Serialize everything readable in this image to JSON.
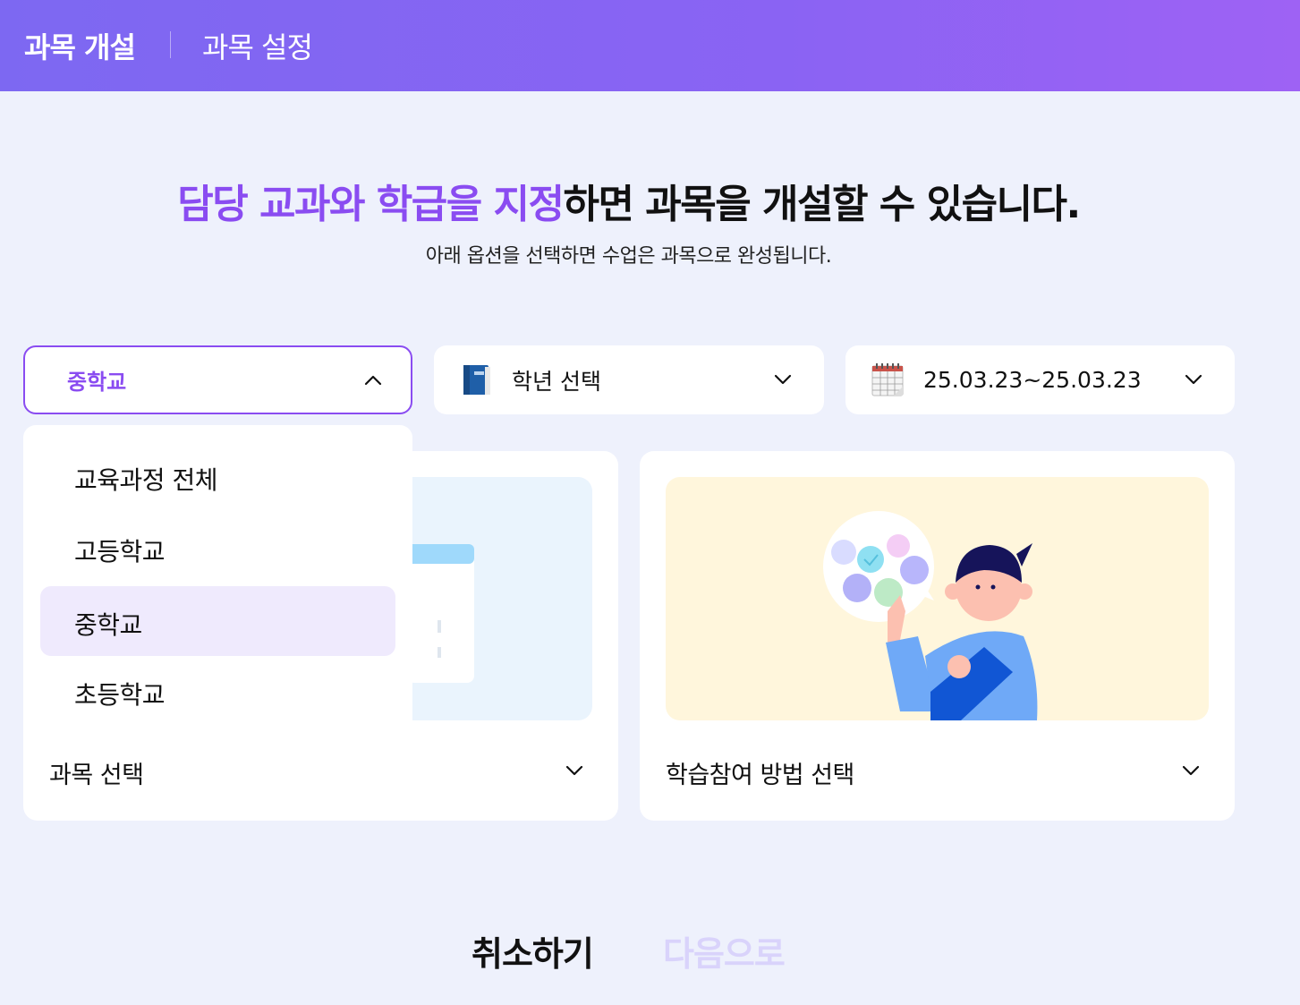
{
  "header": {
    "tab_main": "과목 개설",
    "tab_sub": "과목 설정"
  },
  "intro": {
    "headline_highlight_1": "담당 교과",
    "headline_mid_1": "와 ",
    "headline_highlight_2": "학급을 지정",
    "headline_rest": "하면 과목을 개설할 수 있습니다.",
    "subline": "아래 옵션을 선택하면 수업은 과목으로 완성됩니다."
  },
  "filters": {
    "school_level": "중학교",
    "grade_placeholder": "학년 선택",
    "date_range": "25.03.23~25.03.23",
    "school_expanded": true
  },
  "school_options": [
    {
      "label": "교육과정 전체",
      "selected": false
    },
    {
      "label": "고등학교",
      "selected": false
    },
    {
      "label": "중학교",
      "selected": true
    },
    {
      "label": "초등학교",
      "selected": false
    }
  ],
  "cards": {
    "subject_label": "과목 선택",
    "method_label": "학습참여 방법 선택"
  },
  "footer": {
    "cancel_label": "취소하기",
    "next_label": "다음으로"
  },
  "colors": {
    "accent": "#8a4cf1",
    "header_start": "#7d68f2",
    "header_end": "#9e62f4",
    "background": "#eef1fc",
    "next_disabled": "#d9d3fb"
  },
  "icons": {
    "grade": "blue-book-icon",
    "date": "calendar-icon",
    "chevron": "chevron-down-icon"
  }
}
